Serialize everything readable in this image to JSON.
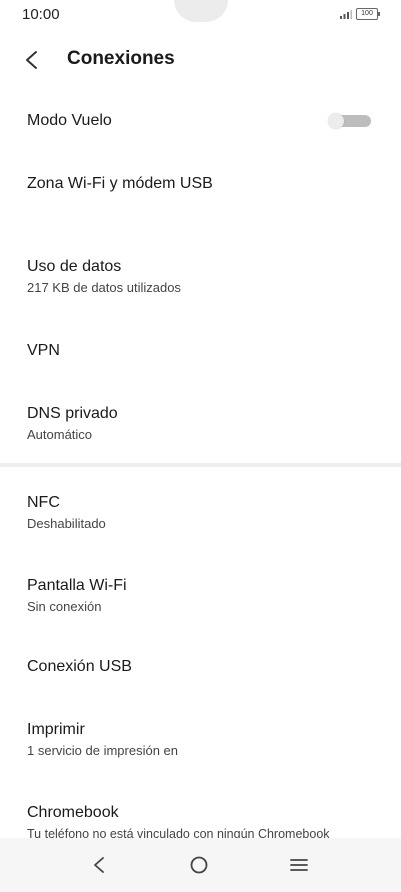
{
  "status": {
    "time": "10:00",
    "battery": "100"
  },
  "header": {
    "title": "Conexiones"
  },
  "items": [
    {
      "title": "Modo Vuelo"
    },
    {
      "title": "Zona Wi-Fi y módem USB"
    },
    {
      "title": "Uso de datos",
      "subtitle": "217 KB de datos utilizados"
    },
    {
      "title": "VPN"
    },
    {
      "title": "DNS privado",
      "subtitle": "Automático"
    },
    {
      "title": "NFC",
      "subtitle": "Deshabilitado"
    },
    {
      "title": "Pantalla Wi-Fi",
      "subtitle": "Sin conexión"
    },
    {
      "title": "Conexión USB"
    },
    {
      "title": "Imprimir",
      "subtitle": "1 servicio de impresión en"
    },
    {
      "title": "Chromebook",
      "subtitle": "Tu teléfono no está vinculado con ningún Chromebook"
    }
  ],
  "toggles": {
    "airplane_mode": false
  },
  "icons": {
    "back": "arrow-left-icon",
    "nav_back": "chevron-left-icon",
    "nav_home": "circle-icon",
    "nav_menu": "menu-icon"
  }
}
